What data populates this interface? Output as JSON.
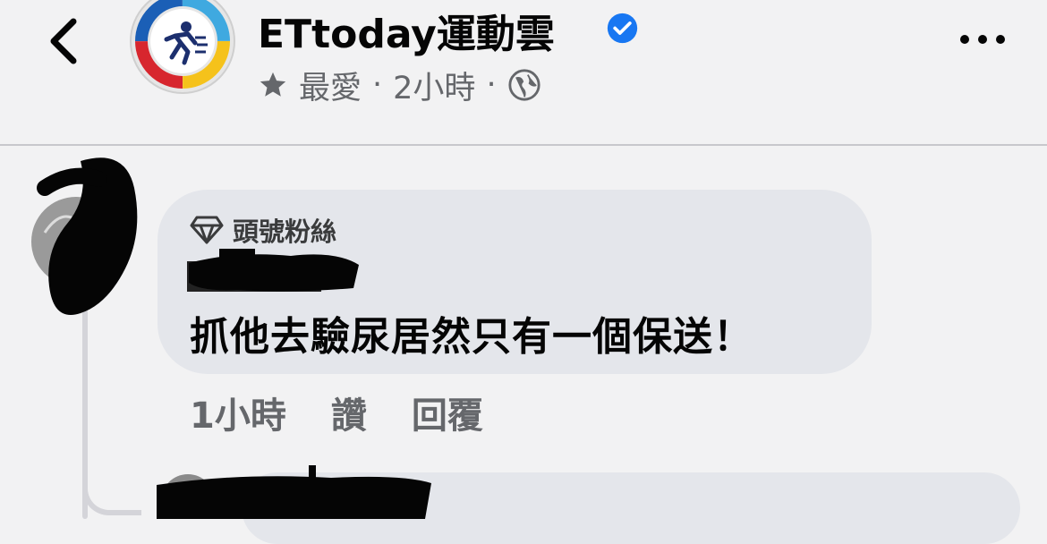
{
  "header": {
    "page_name": "ETtoday運動雲",
    "meta_favorite": "最愛",
    "meta_separator": "·",
    "meta_time": "2小時",
    "meta_separator2": "·"
  },
  "comment": {
    "badge": "頭號粉絲",
    "text": "抓他去驗尿居然只有一個保送！",
    "time": "1小時",
    "like_label": "讚",
    "reply_label": "回覆"
  },
  "colors": {
    "verified": "#1877f2",
    "bubble": "#e4e6eb",
    "muted_text": "#65676b",
    "background": "#f2f2f3"
  },
  "icons": [
    "back-arrow-icon",
    "verified-badge-icon",
    "star-icon",
    "globe-icon",
    "more-options-icon",
    "diamond-icon"
  ]
}
